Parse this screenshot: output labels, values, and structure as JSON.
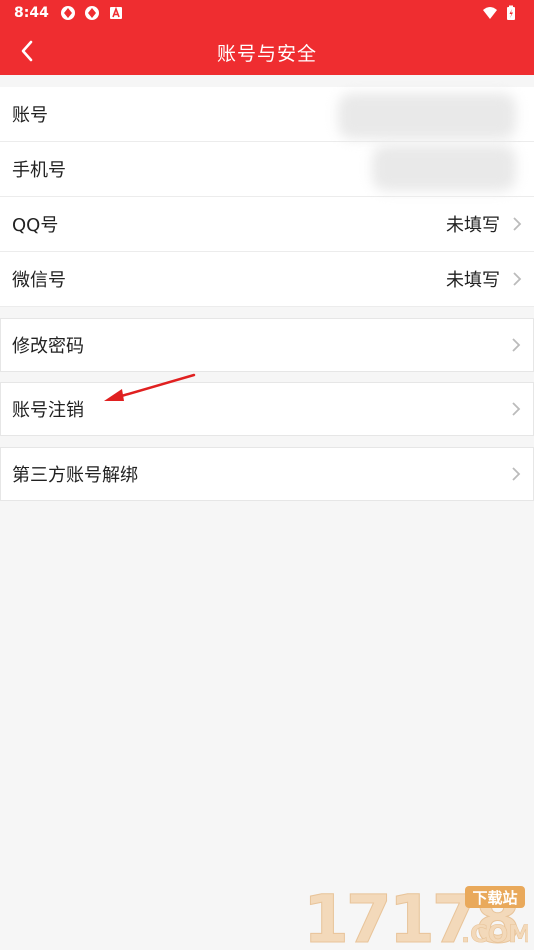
{
  "status": {
    "time": "8:44"
  },
  "header": {
    "title": "账号与安全"
  },
  "account_rows": [
    {
      "label": "账号",
      "value": ""
    },
    {
      "label": "手机号",
      "value": ""
    },
    {
      "label": "QQ号",
      "value": "未填写"
    },
    {
      "label": "微信号",
      "value": "未填写"
    }
  ],
  "menu": [
    {
      "label": "修改密码"
    },
    {
      "label": "账号注销"
    },
    {
      "label": "第三方账号解绑"
    }
  ],
  "watermark": {
    "number": "17178",
    "tag": "下载站",
    "suffix": ".COM"
  },
  "colors": {
    "accent": "#ef2d30",
    "annotation_arrow": "#e02020"
  }
}
